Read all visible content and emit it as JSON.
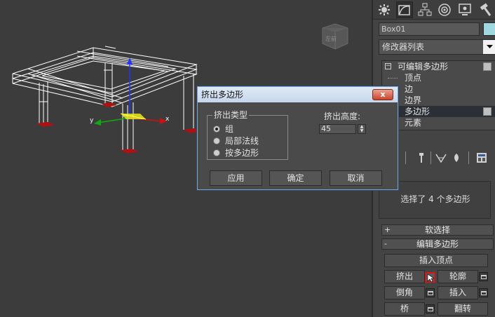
{
  "viewport": {
    "axis_x_label": "x",
    "axis_y_label": "y",
    "viewcube_label": "左前"
  },
  "panel": {
    "tabs": [
      {
        "icon": "create-sun-icon"
      },
      {
        "icon": "modify-curve-icon"
      },
      {
        "icon": "hierarchy-icon"
      },
      {
        "icon": "motion-icon"
      },
      {
        "icon": "display-monitor-icon"
      },
      {
        "icon": "utilities-hammer-icon"
      }
    ],
    "object_name": "Box01",
    "object_color": "#9fd9e0",
    "modifier_list": "修改器列表",
    "stack": {
      "root": "可编辑多边形",
      "subobjects": [
        "顶点",
        "边",
        "边界",
        "多边形",
        "元素"
      ],
      "selected": "多边形"
    },
    "selection_info": "选择了 4 个多边形",
    "rollouts": {
      "soft_selection": {
        "sign": "+",
        "label": "软选择"
      },
      "edit_polygons": {
        "sign": "-",
        "label": "编辑多边形"
      }
    },
    "buttons": {
      "insert_vertex": "插入顶点",
      "extrude": "挤出",
      "outline": "轮廓",
      "bevel": "倒角",
      "inset": "插入",
      "bridge": "桥",
      "flip": "翻转"
    }
  },
  "dialog": {
    "title": "挤出多边形",
    "close_label": "x",
    "extrusion_type_label": "挤出类型",
    "options": [
      "组",
      "局部法线",
      "按多边形"
    ],
    "selected_option": "组",
    "height_label": "挤出高度:",
    "height_value": "45",
    "apply": "应用",
    "ok": "确定",
    "cancel": "取消"
  }
}
